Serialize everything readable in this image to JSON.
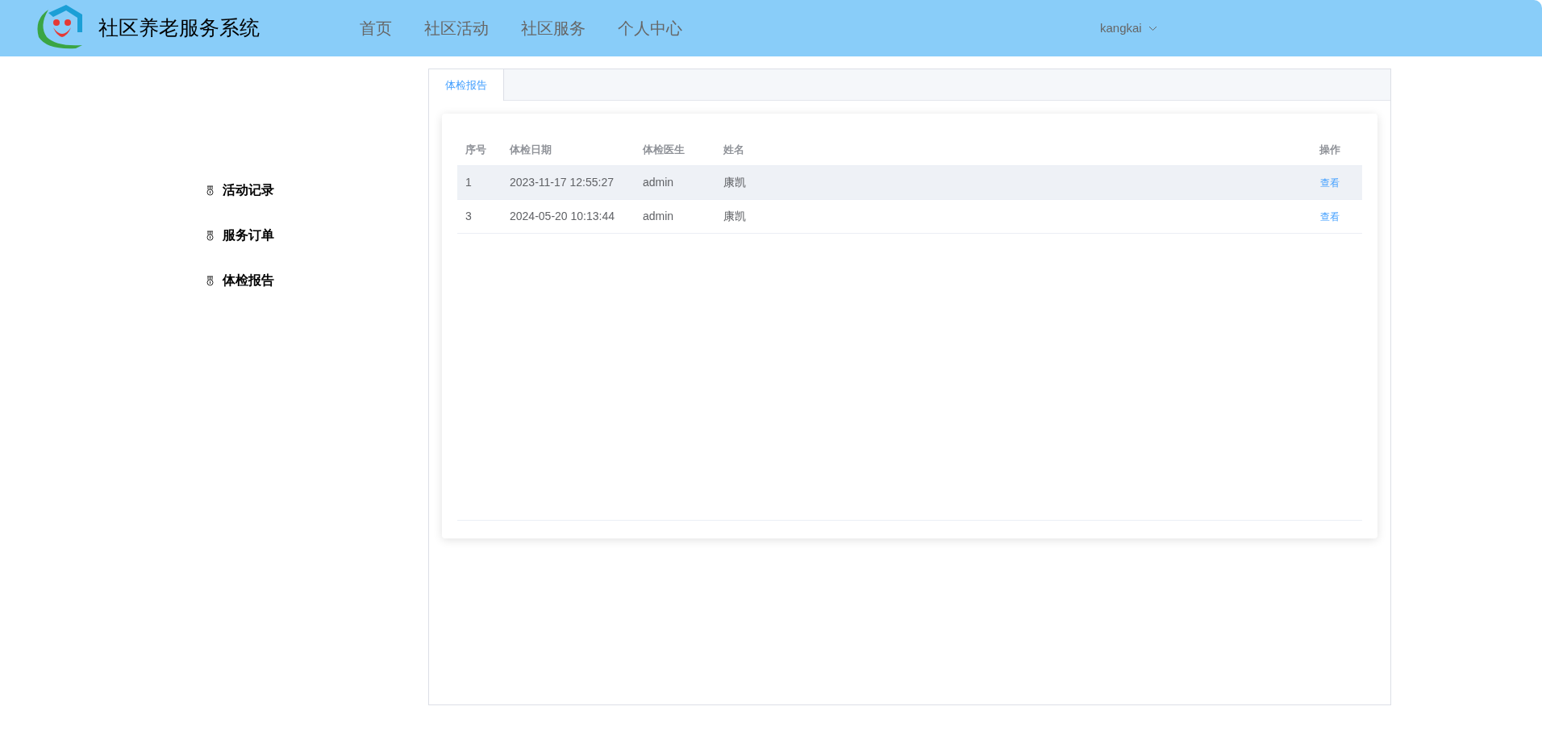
{
  "header": {
    "title": "社区养老服务系统",
    "nav": [
      {
        "label": "首页"
      },
      {
        "label": "社区活动"
      },
      {
        "label": "社区服务"
      },
      {
        "label": "个人中心"
      }
    ],
    "user": "kangkai"
  },
  "sidebar": {
    "items": [
      {
        "label": "活动记录"
      },
      {
        "label": "服务订单"
      },
      {
        "label": "体检报告"
      }
    ]
  },
  "tabs": [
    {
      "label": "体检报告",
      "selected": true
    }
  ],
  "table": {
    "columns": [
      "序号",
      "体检日期",
      "体检医生",
      "姓名",
      "操作"
    ],
    "rows": [
      {
        "cells": [
          "1",
          "2023-11-17 12:55:27",
          "admin",
          "康凯"
        ],
        "action": "查看",
        "highlighted": true
      },
      {
        "cells": [
          "3",
          "2024-05-20 10:13:44",
          "admin",
          "康凯"
        ],
        "action": "查看",
        "highlighted": false
      }
    ]
  }
}
